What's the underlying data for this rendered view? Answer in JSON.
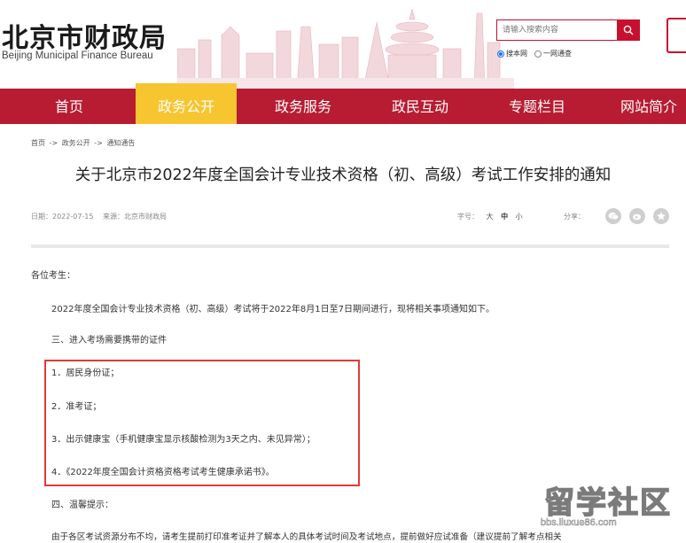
{
  "header": {
    "logo_cn": "北京市财政局",
    "logo_en": "Beijing Municipal Finance Bureau",
    "search_placeholder": "请输入搜索内容",
    "radio_site": "搜本网",
    "radio_all": "一网通查",
    "brand_color": "#b71c32"
  },
  "nav": {
    "items": [
      "首页",
      "政务公开",
      "政务服务",
      "政民互动",
      "专题栏目",
      "网站简介"
    ],
    "active_index": 1,
    "active_color": "#f6c530"
  },
  "breadcrumb": [
    "首页",
    "->",
    "政务公开",
    "->",
    "通知通告"
  ],
  "article": {
    "title": "关于北京市2022年度全国会计专业技术资格（初、高级）考试工作安排的通知",
    "date": "日期：2022-07-15",
    "source": "来源：北京市财政局",
    "font_label": "字号：",
    "font_large": "大",
    "font_medium": "中",
    "font_small": "小",
    "share_label": "分享：",
    "greeting": "各位考生：",
    "intro": "2022年度全国会计专业技术资格（初、高级）考试将于2022年8月1日至7日期间进行，现将相关事项通知如下。",
    "section3": "三、进入考场需要携带的证件",
    "items": [
      "1．居民身份证；",
      "2．准考证；",
      "3．出示健康宝（手机健康宝显示核酸检测为3天之内、未见异常）；",
      "4．《2022年度全国会计资格资格考试考生健康承诺书》。"
    ],
    "section4": "四、温馨提示：",
    "tip": "由于各区考试资源分布不均，请考生提前打印准考证并了解本人的具体考试时间及考试地点，提前做好应试准备（建议提前了解考点相关"
  },
  "watermark": {
    "title": "留学社区",
    "url": "bbs.liuxue86.com"
  }
}
